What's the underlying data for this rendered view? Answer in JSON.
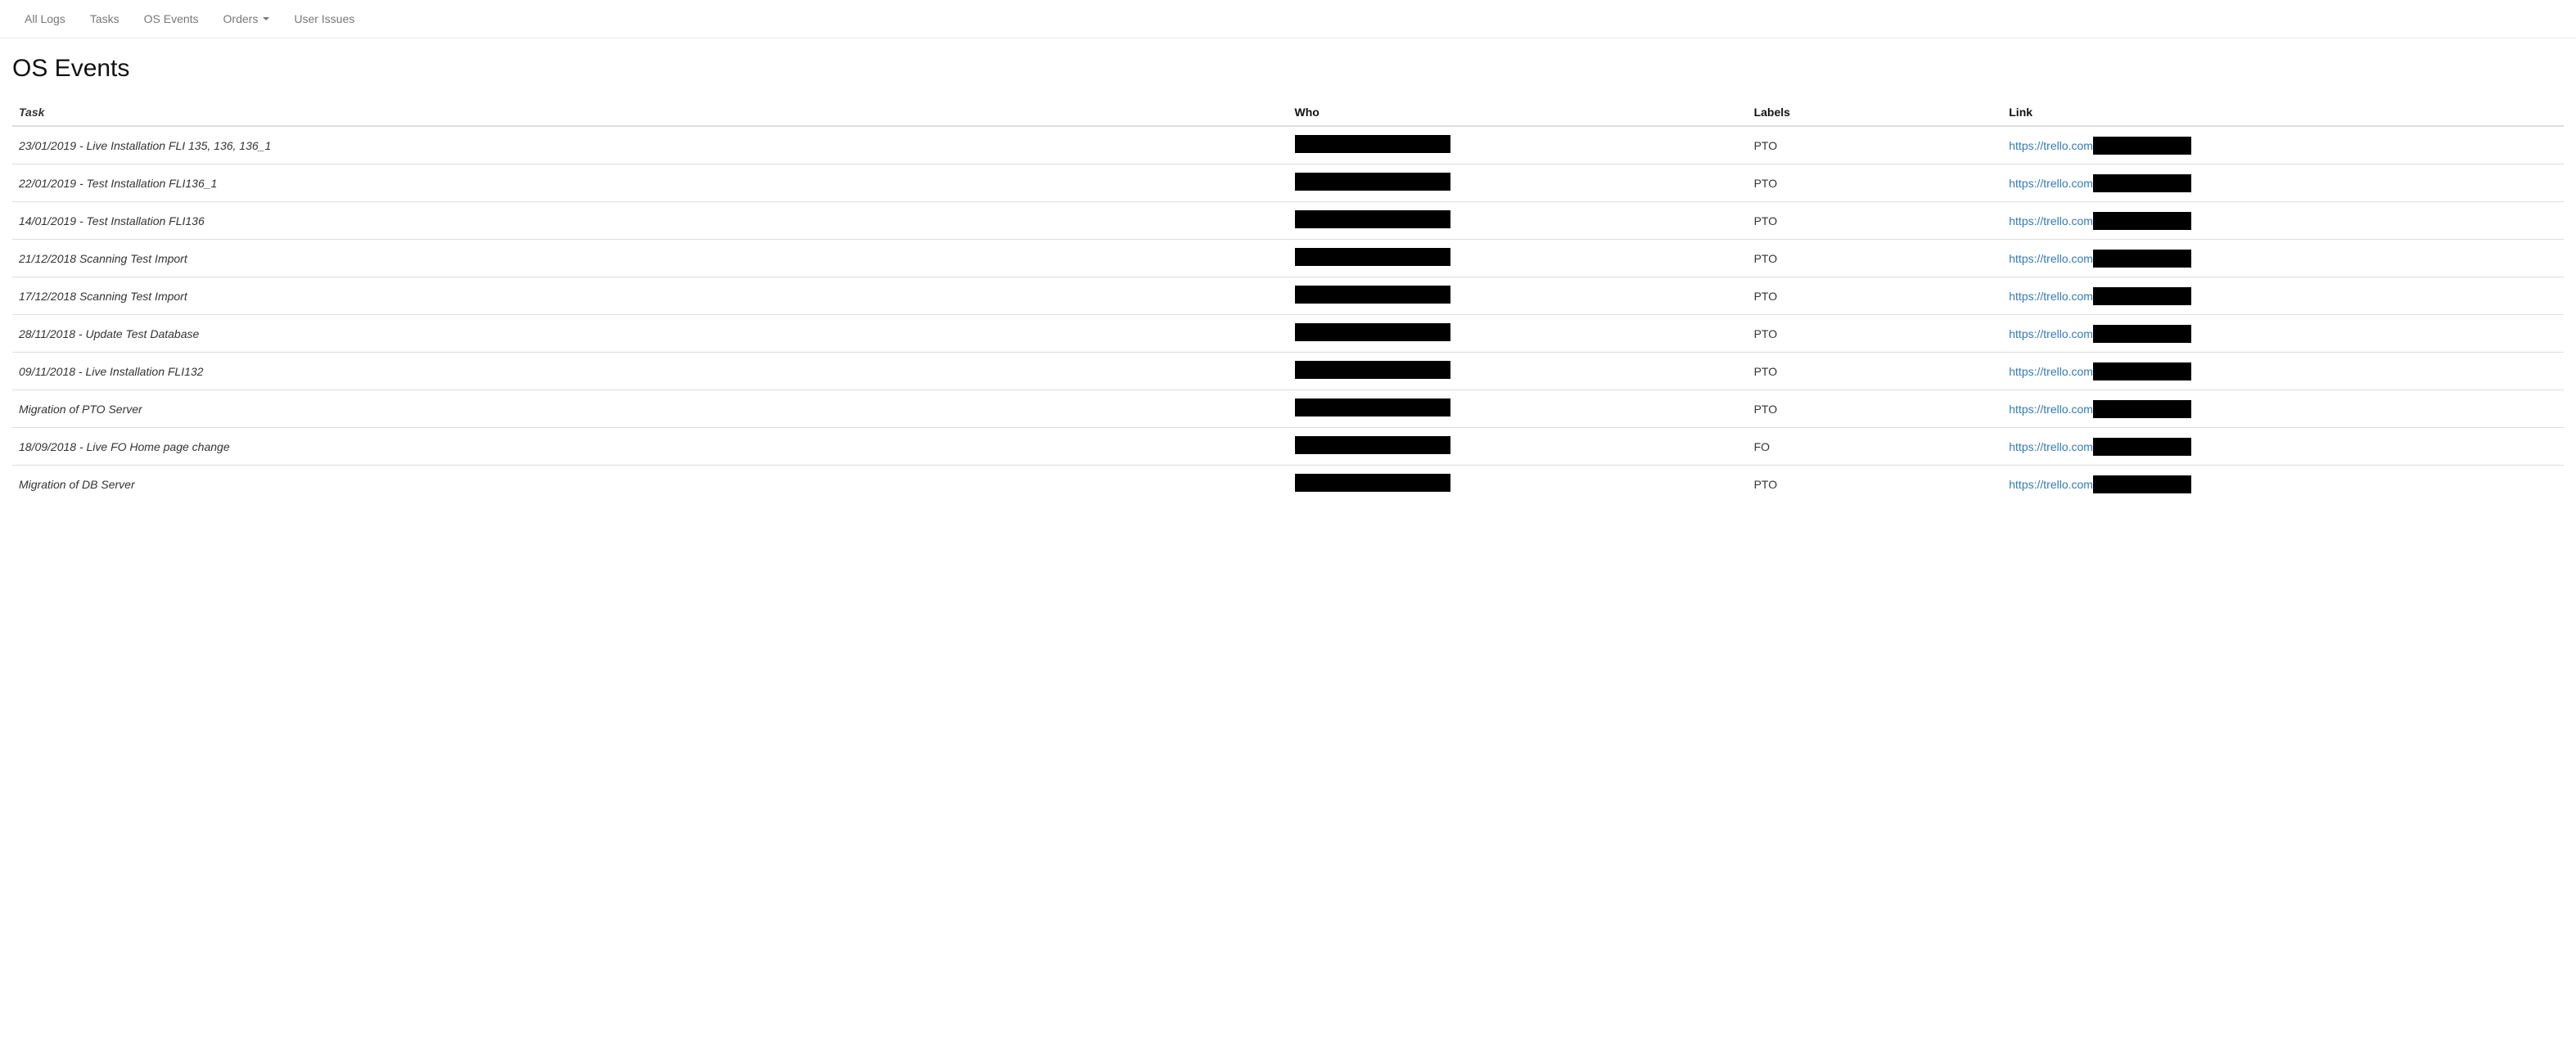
{
  "nav": {
    "items": [
      {
        "label": "All Logs"
      },
      {
        "label": "Tasks"
      },
      {
        "label": "OS Events"
      },
      {
        "label": "Orders",
        "dropdown": true
      },
      {
        "label": "User Issues"
      }
    ]
  },
  "page": {
    "title": "OS Events"
  },
  "table": {
    "headers": {
      "task": "Task",
      "who": "Who",
      "labels": "Labels",
      "link": "Link"
    },
    "rows": [
      {
        "task": "23/01/2019 - Live Installation FLI 135, 136, 136_1",
        "who": "",
        "labels": "PTO",
        "link": "https://trello.com"
      },
      {
        "task": "22/01/2019 - Test Installation FLI136_1",
        "who": "",
        "labels": "PTO",
        "link": "https://trello.com"
      },
      {
        "task": "14/01/2019 - Test Installation FLI136",
        "who": "",
        "labels": "PTO",
        "link": "https://trello.com"
      },
      {
        "task": "21/12/2018 Scanning Test Import",
        "who": "",
        "labels": "PTO",
        "link": "https://trello.com"
      },
      {
        "task": "17/12/2018 Scanning Test Import",
        "who": "",
        "labels": "PTO",
        "link": "https://trello.com"
      },
      {
        "task": "28/11/2018 - Update Test Database",
        "who": "",
        "labels": "PTO",
        "link": "https://trello.com"
      },
      {
        "task": "09/11/2018 - Live Installation FLI132",
        "who": "",
        "labels": "PTO",
        "link": "https://trello.com"
      },
      {
        "task": "Migration of PTO Server",
        "who": "",
        "labels": "PTO",
        "link": "https://trello.com"
      },
      {
        "task": "18/09/2018 - Live FO Home page change",
        "who": "",
        "labels": "FO",
        "link": "https://trello.com"
      },
      {
        "task": "Migration of DB Server",
        "who": "",
        "labels": "PTO",
        "link": "https://trello.com"
      }
    ]
  }
}
